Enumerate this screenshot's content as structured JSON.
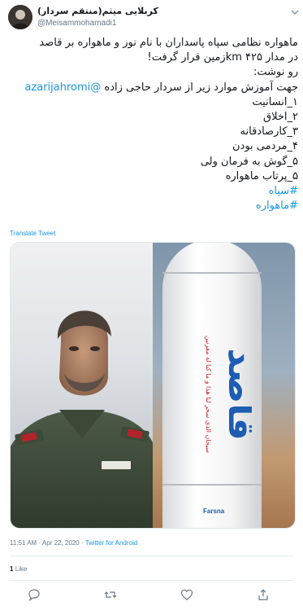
{
  "tweet": {
    "display_name": "کربلایی میثم(منتقم سردار)",
    "handle": "@Meisammohamadi1",
    "lines": [
      "ماهواره نظامی سپاه پاسداران با نام نور و ماهواره بر قاصد",
      "در مدار km ۴۲۵زمین قرار گرفت!",
      "رو نوشت:",
      "@azarijahromi",
      "جهت آموزش موارد زیر از سردار حاجی زاده",
      "۱_انسانیت",
      "۲_اخلاق",
      "۳_کارصادقانه",
      "۴_مردمی بودن",
      "۵_گوش به فرمان ولی",
      "۵_پرتاب ماهواره",
      "#سپاه",
      "#ماهواره"
    ],
    "translate_label": "Translate Tweet",
    "rocket_text": "قاصد",
    "rocket_subtext": "سبحان الذی سخر لنا هذا و ما کنا له مقرنین",
    "watermark": "Farsna",
    "time": "11:51 AM",
    "date": "Apr 22, 2020",
    "source": "Twitter for Android",
    "like_count": "1",
    "like_label": "Like",
    "colors": {
      "link": "#1b95e0",
      "text": "#14171a",
      "muted": "#657786",
      "rocket_blue": "#1d5db3",
      "rocket_red": "#c0272d"
    }
  }
}
